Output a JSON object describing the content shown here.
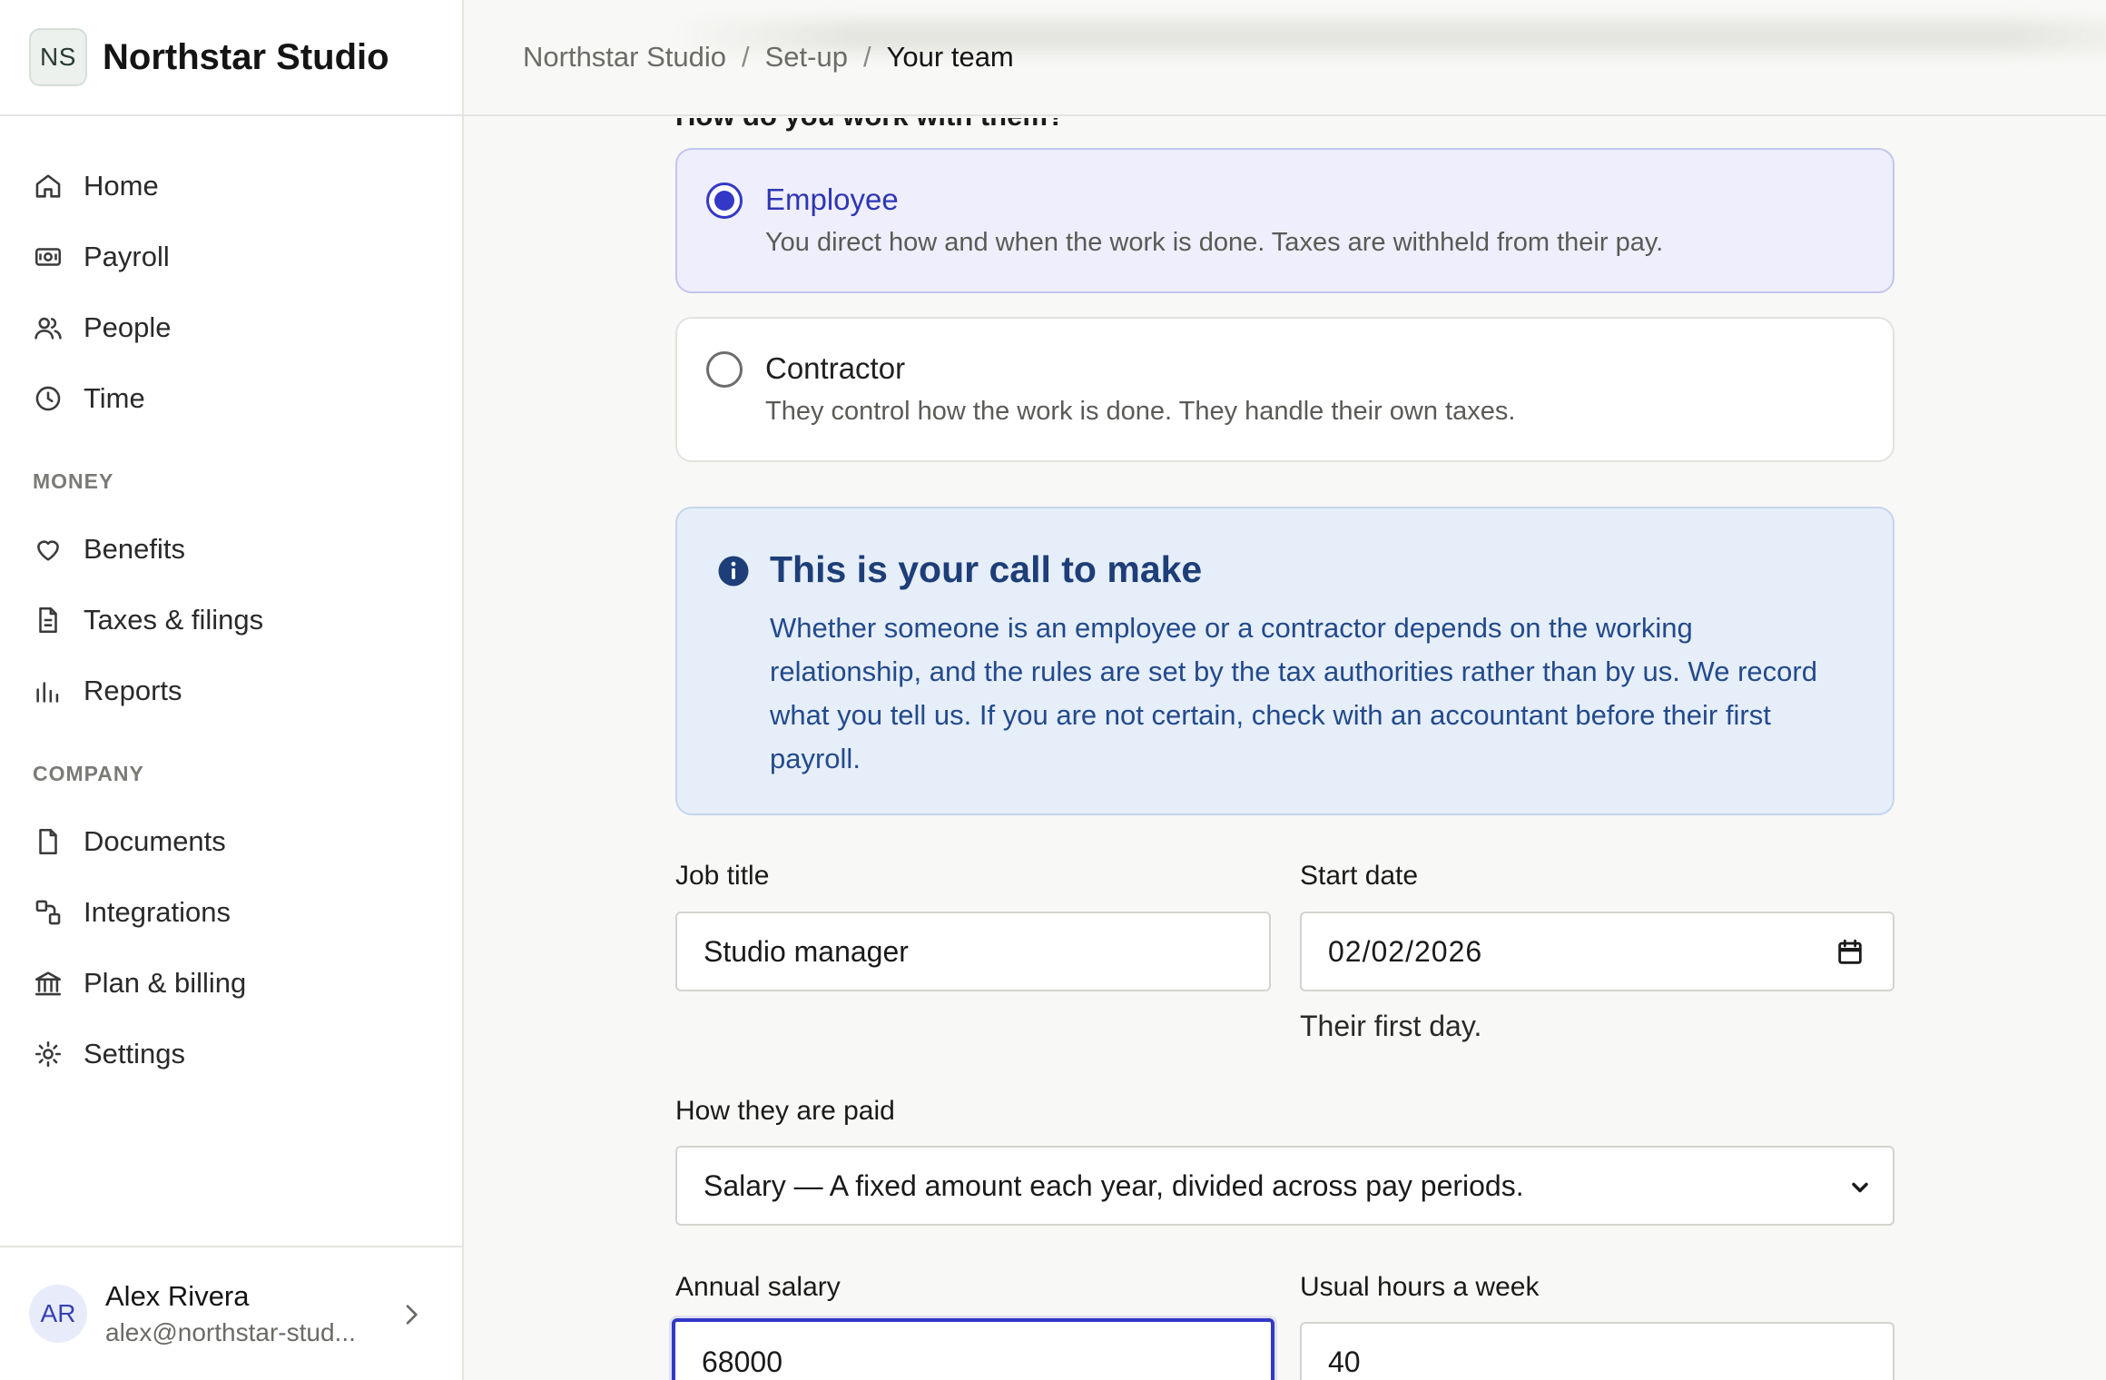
{
  "brand": {
    "initials": "NS",
    "name": "Northstar Studio"
  },
  "nav": {
    "main": [
      {
        "label": "Home",
        "icon": "home-icon"
      },
      {
        "label": "Payroll",
        "icon": "payroll-icon"
      },
      {
        "label": "People",
        "icon": "people-icon"
      },
      {
        "label": "Time",
        "icon": "clock-icon"
      }
    ],
    "money_heading": "MONEY",
    "money": [
      {
        "label": "Benefits",
        "icon": "heart-icon"
      },
      {
        "label": "Taxes & filings",
        "icon": "document-icon"
      },
      {
        "label": "Reports",
        "icon": "bar-chart-icon"
      }
    ],
    "company_heading": "COMPANY",
    "company": [
      {
        "label": "Documents",
        "icon": "file-icon"
      },
      {
        "label": "Integrations",
        "icon": "integrations-icon"
      },
      {
        "label": "Plan & billing",
        "icon": "bank-icon"
      },
      {
        "label": "Settings",
        "icon": "gear-icon"
      }
    ]
  },
  "user": {
    "initials": "AR",
    "name": "Alex Rivera",
    "email": "alex@northstar-stud..."
  },
  "breadcrumb": {
    "root": "Northstar Studio",
    "middle": "Set-up",
    "current": "Your team",
    "separator": "/"
  },
  "form": {
    "question": "How do you work with them?",
    "options": [
      {
        "title": "Employee",
        "description": "You direct how and when the work is done. Taxes are withheld from their pay.",
        "selected": true
      },
      {
        "title": "Contractor",
        "description": "They control how the work is done. They handle their own taxes.",
        "selected": false
      }
    ],
    "callout": {
      "title": "This is your call to make",
      "body": "Whether someone is an employee or a contractor depends on the working relationship, and the rules are set by the tax authorities rather than by us. We record what you tell us. If you are not certain, check with an accountant before their first payroll."
    },
    "job_title": {
      "label": "Job title",
      "value": "Studio manager"
    },
    "start_date": {
      "label": "Start date",
      "value": "02/02/2026",
      "help": "Their first day."
    },
    "pay_type": {
      "label": "How they are paid",
      "value": "Salary — A fixed amount each year, divided across pay periods."
    },
    "annual_salary": {
      "label": "Annual salary",
      "value": "68000"
    },
    "hours": {
      "label": "Usual hours a week",
      "value": "40"
    }
  },
  "colors": {
    "accent": "#3438c6",
    "callout_bg": "#e6eef9",
    "callout_text": "#1d3e78",
    "selected_bg": "#eeeefc"
  }
}
